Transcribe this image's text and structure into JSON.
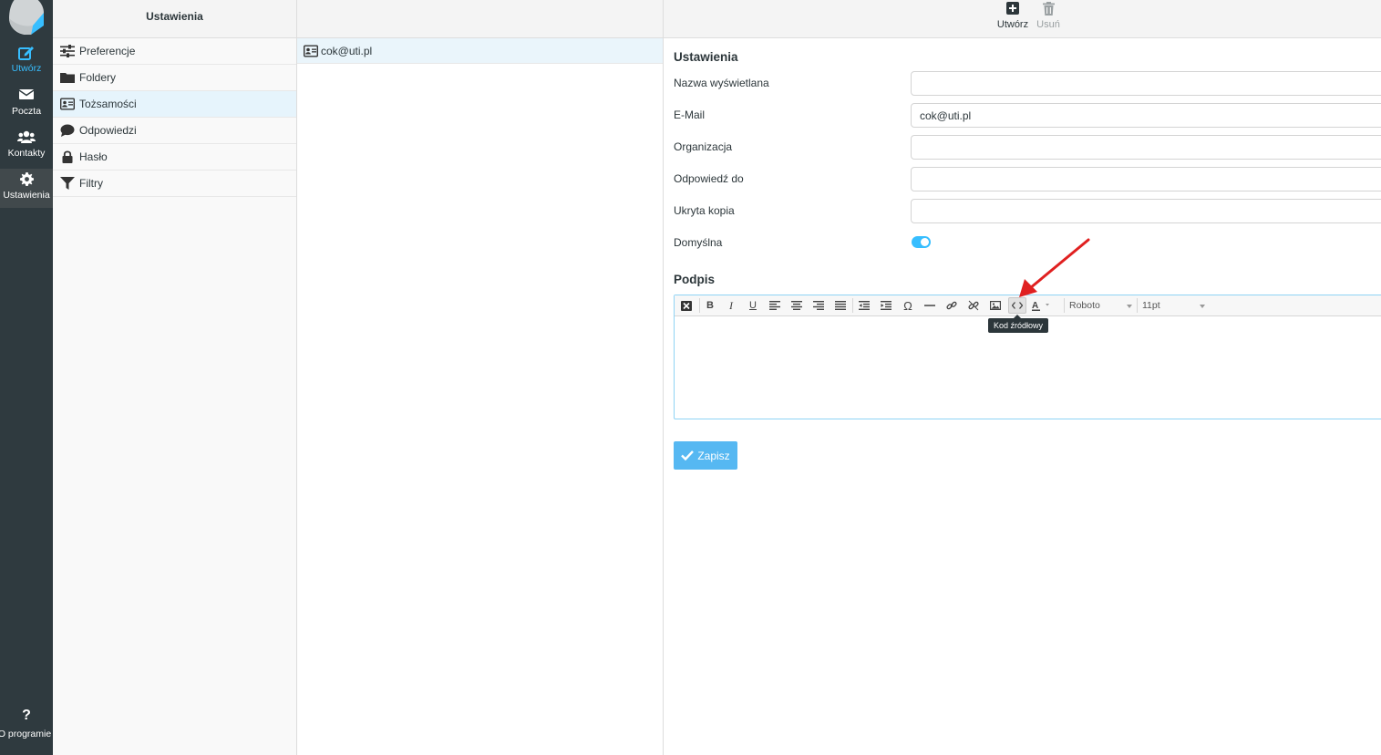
{
  "rail": {
    "items": [
      {
        "label": "Utwórz",
        "icon": "compose-icon"
      },
      {
        "label": "Poczta",
        "icon": "envelope-icon"
      },
      {
        "label": "Kontakty",
        "icon": "users-icon"
      },
      {
        "label": "Ustawienia",
        "icon": "gear-icon"
      }
    ],
    "about": {
      "label": "O programie",
      "icon": "question-icon"
    }
  },
  "settings_list": {
    "title": "Ustawienia",
    "items": [
      {
        "label": "Preferencje",
        "icon": "sliders-icon"
      },
      {
        "label": "Foldery",
        "icon": "folder-icon"
      },
      {
        "label": "Tożsamości",
        "icon": "id-card-icon",
        "active": true
      },
      {
        "label": "Odpowiedzi",
        "icon": "comment-icon"
      },
      {
        "label": "Hasło",
        "icon": "lock-icon"
      },
      {
        "label": "Filtry",
        "icon": "filter-icon"
      }
    ]
  },
  "identities": {
    "items": [
      {
        "label": "cok@uti.pl",
        "icon": "id-card-icon"
      }
    ]
  },
  "toolbar": {
    "create_label": "Utwórz",
    "delete_label": "Usuń"
  },
  "form": {
    "title": "Ustawienia",
    "fields": [
      {
        "label": "Nazwa wyświetlana",
        "value": ""
      },
      {
        "label": "E-Mail",
        "value": "cok@uti.pl"
      },
      {
        "label": "Organizacja",
        "value": ""
      },
      {
        "label": "Odpowiedź do",
        "value": ""
      },
      {
        "label": "Ukryta kopia",
        "value": ""
      }
    ],
    "default_label": "Domyślna",
    "default_on": true,
    "signature_title": "Podpis",
    "editor": {
      "font": "Roboto",
      "size": "11pt",
      "tooltip": "Kod źródłowy"
    },
    "save_label": "Zapisz"
  },
  "colors": {
    "accent": "#37beff",
    "rail_bg": "#2f3a3f",
    "save_bg": "#56b8f2",
    "annotation_arrow": "#e02020"
  }
}
